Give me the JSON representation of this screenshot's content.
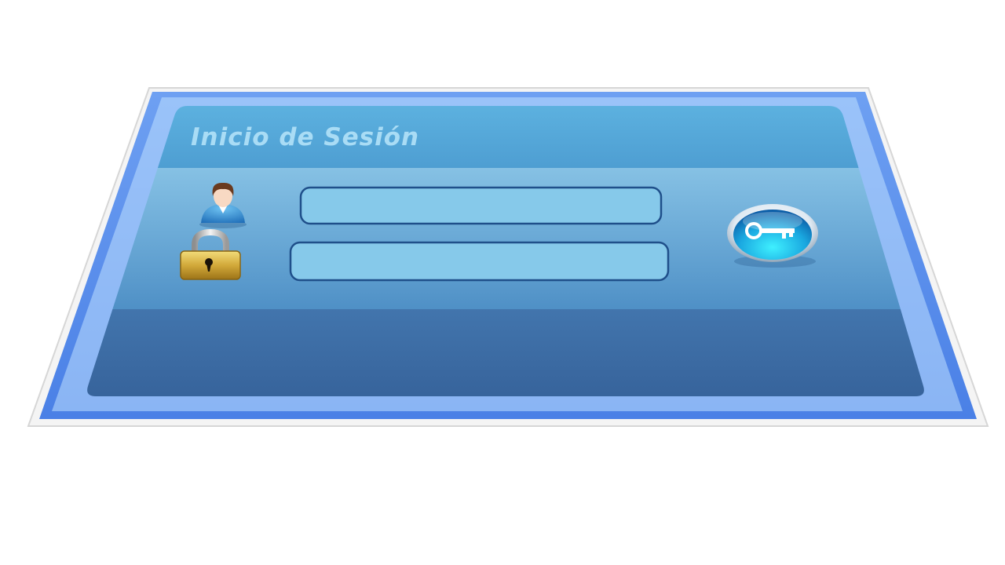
{
  "login": {
    "title": "Inicio de Sesión",
    "username_value": "",
    "password_value": "",
    "user_icon": "user-avatar-icon",
    "lock_icon": "padlock-icon",
    "submit_icon": "key-icon"
  },
  "colors": {
    "frame_glow": "#4f86ea",
    "header_band": "#57acdc",
    "form_band": "#78b8e0",
    "footer_band": "#3d6fa6",
    "field_fill": "#86c9ea",
    "field_border": "#1f4f8a",
    "title_text": "#a9dcf5"
  }
}
